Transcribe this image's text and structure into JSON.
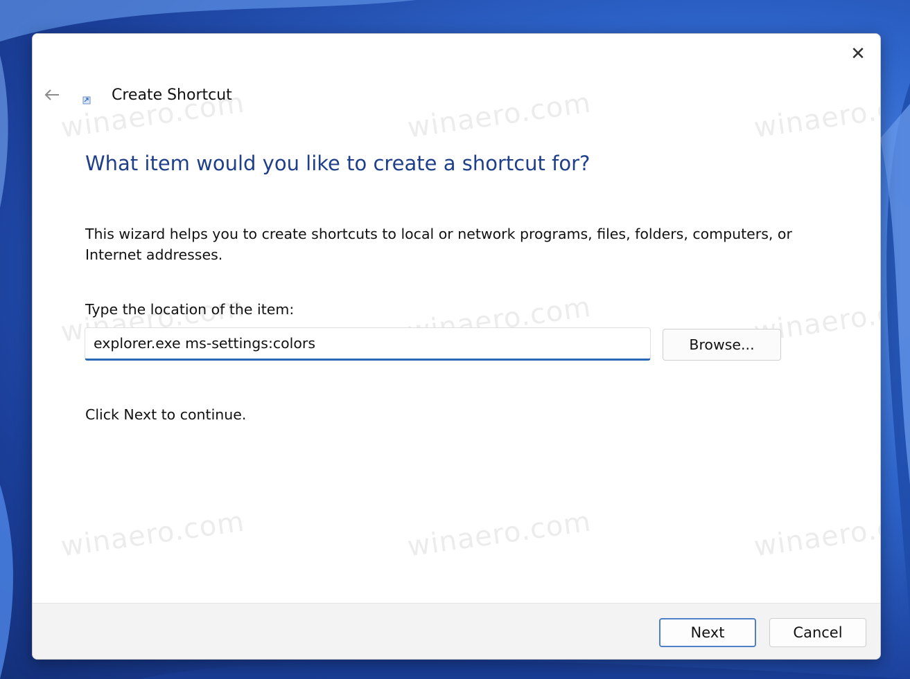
{
  "window": {
    "title": "Create Shortcut",
    "close_glyph": "✕",
    "back_icon": "back-arrow-icon",
    "app_icon": "shortcut-icon"
  },
  "content": {
    "heading": "What item would you like to create a shortcut for?",
    "description": "This wizard helps you to create shortcuts to local or network programs, files, folders, computers, or Internet addresses.",
    "location_label": "Type the location of the item:",
    "location_value": "explorer.exe ms-settings:colors",
    "browse_label": "Browse...",
    "hint": "Click Next to continue."
  },
  "footer": {
    "next_label": "Next",
    "cancel_label": "Cancel"
  },
  "watermark": {
    "text": "winaero.com"
  },
  "colors": {
    "heading": "#1f3f8a",
    "accent": "#2a67b5",
    "footer_bg": "#f3f3f3"
  }
}
